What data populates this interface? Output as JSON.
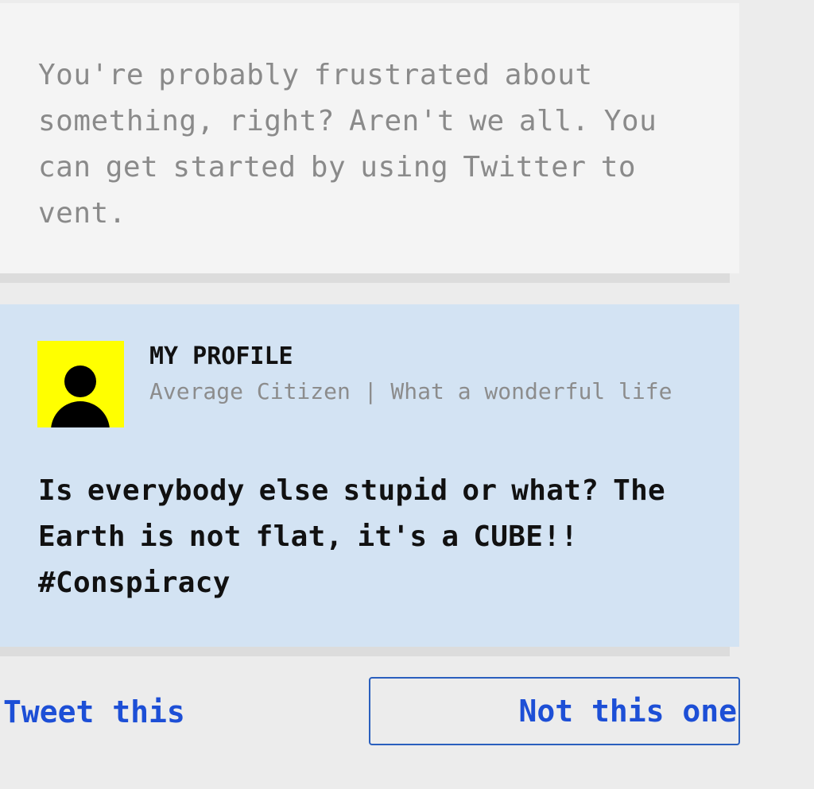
{
  "intro": {
    "text": "You're probably frustrated about something, right? Aren't we all. You can get started by using Twitter to vent."
  },
  "tweet": {
    "profile_name": "MY PROFILE",
    "profile_bio": "Average Citizen | What a wonderful life",
    "text": "Is everybody else stupid or what? The Earth is not flat, it's a CUBE!! #Conspiracy",
    "avatar_icon": "person-silhouette-icon",
    "avatar_color": "#ffff00"
  },
  "actions": {
    "tweet_label": "Tweet this",
    "skip_label": "Not this one"
  },
  "colors": {
    "intro_bg": "#f4f4f4",
    "tweet_bg": "#d3e3f3",
    "accent": "#1d4fd6"
  }
}
